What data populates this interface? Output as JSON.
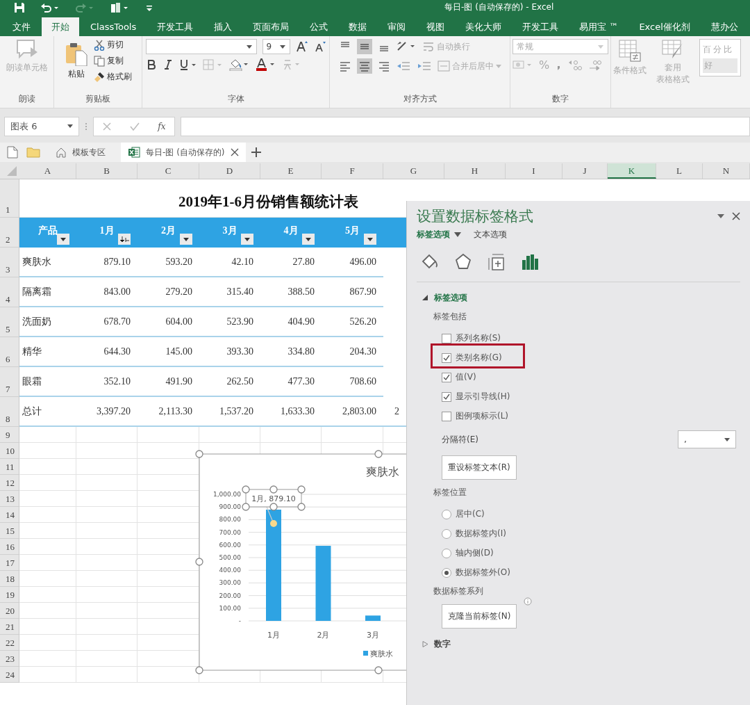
{
  "window": {
    "title": "每日-图 (自动保存的) - Excel"
  },
  "ribbon_tabs": [
    {
      "label": "文件",
      "selected": false
    },
    {
      "label": "开始",
      "selected": true
    },
    {
      "label": "ClassTools",
      "selected": false
    },
    {
      "label": "开发工具",
      "selected": false
    },
    {
      "label": "插入",
      "selected": false
    },
    {
      "label": "页面布局",
      "selected": false
    },
    {
      "label": "公式",
      "selected": false
    },
    {
      "label": "数据",
      "selected": false
    },
    {
      "label": "审阅",
      "selected": false
    },
    {
      "label": "视图",
      "selected": false
    },
    {
      "label": "美化大师",
      "selected": false
    },
    {
      "label": "开发工具",
      "selected": false
    },
    {
      "label": "易用宝 ™",
      "selected": false
    },
    {
      "label": "Excel催化剂",
      "selected": false
    },
    {
      "label": "慧办公",
      "selected": false
    }
  ],
  "ribbon": {
    "read": {
      "label": "朗读",
      "button": "朗读单元格",
      "disabled": true
    },
    "clipboard": {
      "label": "剪贴板",
      "paste": "粘贴",
      "cut": "剪切",
      "copy": "复制",
      "painter": "格式刷"
    },
    "font": {
      "label": "字体",
      "size": "9"
    },
    "alignment": {
      "label": "对齐方式",
      "wrap": "自动换行",
      "merge": "合并后居中",
      "disabled": true
    },
    "number": {
      "label": "数字",
      "format": "常规",
      "percent": "%",
      "disabled": true
    },
    "styles": {
      "conditional": "条件格式",
      "table_format": [
        "套用",
        "表格格式"
      ],
      "gallery": [
        "百分比",
        "好"
      ],
      "disabled": true
    }
  },
  "formula_bar": {
    "name_box": "图表 6",
    "function_label": "fx"
  },
  "file_tabs": [
    {
      "label": "模板专区",
      "kind": "home",
      "selected": false
    },
    {
      "label": "每日-图 (自动保存的)",
      "kind": "workbook",
      "selected": true
    }
  ],
  "sheet": {
    "columns": [
      {
        "label": "A",
        "selected": false
      },
      {
        "label": "B",
        "selected": false
      },
      {
        "label": "C",
        "selected": false
      },
      {
        "label": "D",
        "selected": false
      },
      {
        "label": "E",
        "selected": false
      },
      {
        "label": "F",
        "selected": false
      },
      {
        "label": "G",
        "selected": false
      },
      {
        "label": "H",
        "selected": false
      },
      {
        "label": "I",
        "selected": false
      },
      {
        "label": "J",
        "selected": false
      },
      {
        "label": "K",
        "selected": true
      },
      {
        "label": "L",
        "selected": false
      },
      {
        "label": "N",
        "selected": false
      }
    ],
    "rows": [
      "1",
      "2",
      "3",
      "4",
      "5",
      "6",
      "7",
      "8",
      "9",
      "10",
      "11",
      "12",
      "13",
      "14",
      "15",
      "16",
      "17",
      "18",
      "19",
      "20",
      "21",
      "22",
      "23",
      "24"
    ],
    "title": "2019年1-6月份销售额统计表",
    "headers": [
      {
        "label": "产品",
        "kind": "dropdown"
      },
      {
        "label": "1月",
        "kind": "sort"
      },
      {
        "label": "2月",
        "kind": "dropdown"
      },
      {
        "label": "3月",
        "kind": "dropdown"
      },
      {
        "label": "4月",
        "kind": "dropdown"
      },
      {
        "label": "5月",
        "kind": "dropdown"
      }
    ],
    "table_rows": [
      {
        "cells": [
          "爽肤水",
          "879.10",
          "593.20",
          "42.10",
          "27.80",
          "496.00"
        ]
      },
      {
        "cells": [
          "隔离霜",
          "843.00",
          "279.20",
          "315.40",
          "388.50",
          "867.90"
        ]
      },
      {
        "cells": [
          "洗面奶",
          "678.70",
          "604.00",
          "523.90",
          "404.90",
          "526.20"
        ]
      },
      {
        "cells": [
          "精华",
          "644.30",
          "145.00",
          "393.30",
          "334.80",
          "204.30"
        ]
      },
      {
        "cells": [
          "眼霜",
          "352.10",
          "491.90",
          "262.50",
          "477.30",
          "708.60"
        ]
      },
      {
        "cells": [
          "总计",
          "3,397.20",
          "2,113.30",
          "1,537.20",
          "1,633.30",
          "2,803.00",
          "2"
        ]
      }
    ]
  },
  "chart": {
    "chart_data": {
      "type": "bar",
      "title": "爽肤水",
      "categories": [
        "1月",
        "2月",
        "3月"
      ],
      "series": [
        {
          "name": "爽肤水",
          "color": "#2ea3e3",
          "values": [
            879.1,
            593.2,
            42.1
          ]
        }
      ],
      "ylim": [
        0,
        1000
      ],
      "yticks": [
        {
          "value": 0,
          "label": "-"
        },
        {
          "value": 100,
          "label": "100.00"
        },
        {
          "value": 200,
          "label": "200.00"
        },
        {
          "value": 300,
          "label": "300.00"
        },
        {
          "value": 400,
          "label": "400.00"
        },
        {
          "value": 500,
          "label": "500.00"
        },
        {
          "value": 600,
          "label": "600.00"
        },
        {
          "value": 700,
          "label": "700.00"
        },
        {
          "value": 800,
          "label": "800.00"
        },
        {
          "value": 900,
          "label": "900.00"
        },
        {
          "value": 1000,
          "label": "1,000.00"
        }
      ],
      "grid": true,
      "annotations": [
        "1月, 879.10"
      ]
    }
  },
  "panel": {
    "title": "设置数据标签格式",
    "tabs": [
      {
        "label": "标签选项",
        "selected": true
      },
      {
        "label": "文本选项",
        "selected": false
      }
    ],
    "icon_tabs": [
      {
        "kind": "fill",
        "selected": false
      },
      {
        "kind": "effects",
        "selected": false
      },
      {
        "kind": "size",
        "selected": false
      },
      {
        "kind": "options",
        "selected": true
      }
    ],
    "label_options": {
      "heading": "标签选项",
      "expanded": true,
      "include_label": "标签包括",
      "checkboxes": [
        {
          "label": "系列名称(S)",
          "checked": false,
          "highlighted": false
        },
        {
          "label": "类别名称(G)",
          "checked": true,
          "highlighted": true
        },
        {
          "label": "值(V)",
          "checked": true,
          "highlighted": false
        },
        {
          "label": "显示引导线(H)",
          "checked": true,
          "highlighted": false
        },
        {
          "label": "图例项标示(L)",
          "checked": false,
          "highlighted": false
        }
      ],
      "separator": {
        "label": "分隔符(E)",
        "value": ","
      },
      "reset_button": "重设标签文本(R)",
      "position_label": "标签位置",
      "positions": [
        {
          "label": "居中(C)",
          "selected": false
        },
        {
          "label": "数据标签内(I)",
          "selected": false
        },
        {
          "label": "轴内侧(D)",
          "selected": false
        },
        {
          "label": "数据标签外(O)",
          "selected": true
        }
      ],
      "series_label": "数据标签系列",
      "clone_button": "克隆当前标签(N)"
    },
    "number_section": {
      "heading": "数字",
      "expanded": false
    }
  }
}
